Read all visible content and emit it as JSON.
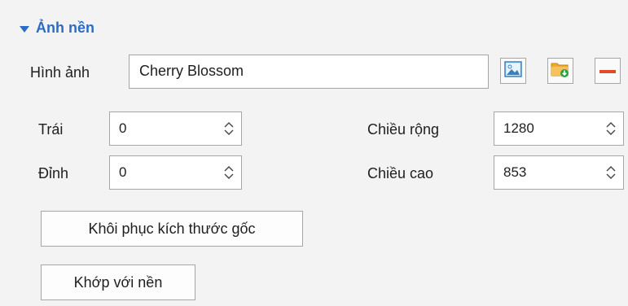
{
  "section": {
    "title": "Ảnh nền",
    "expanded": true
  },
  "image": {
    "label": "Hình ảnh",
    "value": "Cherry Blossom",
    "buttons": {
      "browse_icon": "picture-icon",
      "open_icon": "folder-download-icon",
      "remove_icon": "minus-icon"
    }
  },
  "position": {
    "left_label": "Trái",
    "left_value": "0",
    "top_label": "Đỉnh",
    "top_value": "0"
  },
  "size": {
    "width_label": "Chiều rộng",
    "width_value": "1280",
    "height_label": "Chiều cao",
    "height_value": "853"
  },
  "actions": {
    "restore_label": "Khôi phục kích thước gốc",
    "fit_label": "Khớp với nền"
  },
  "colors": {
    "accent": "#2b6cc4",
    "remove": "#e24b2a",
    "folder": "#f0a830"
  }
}
